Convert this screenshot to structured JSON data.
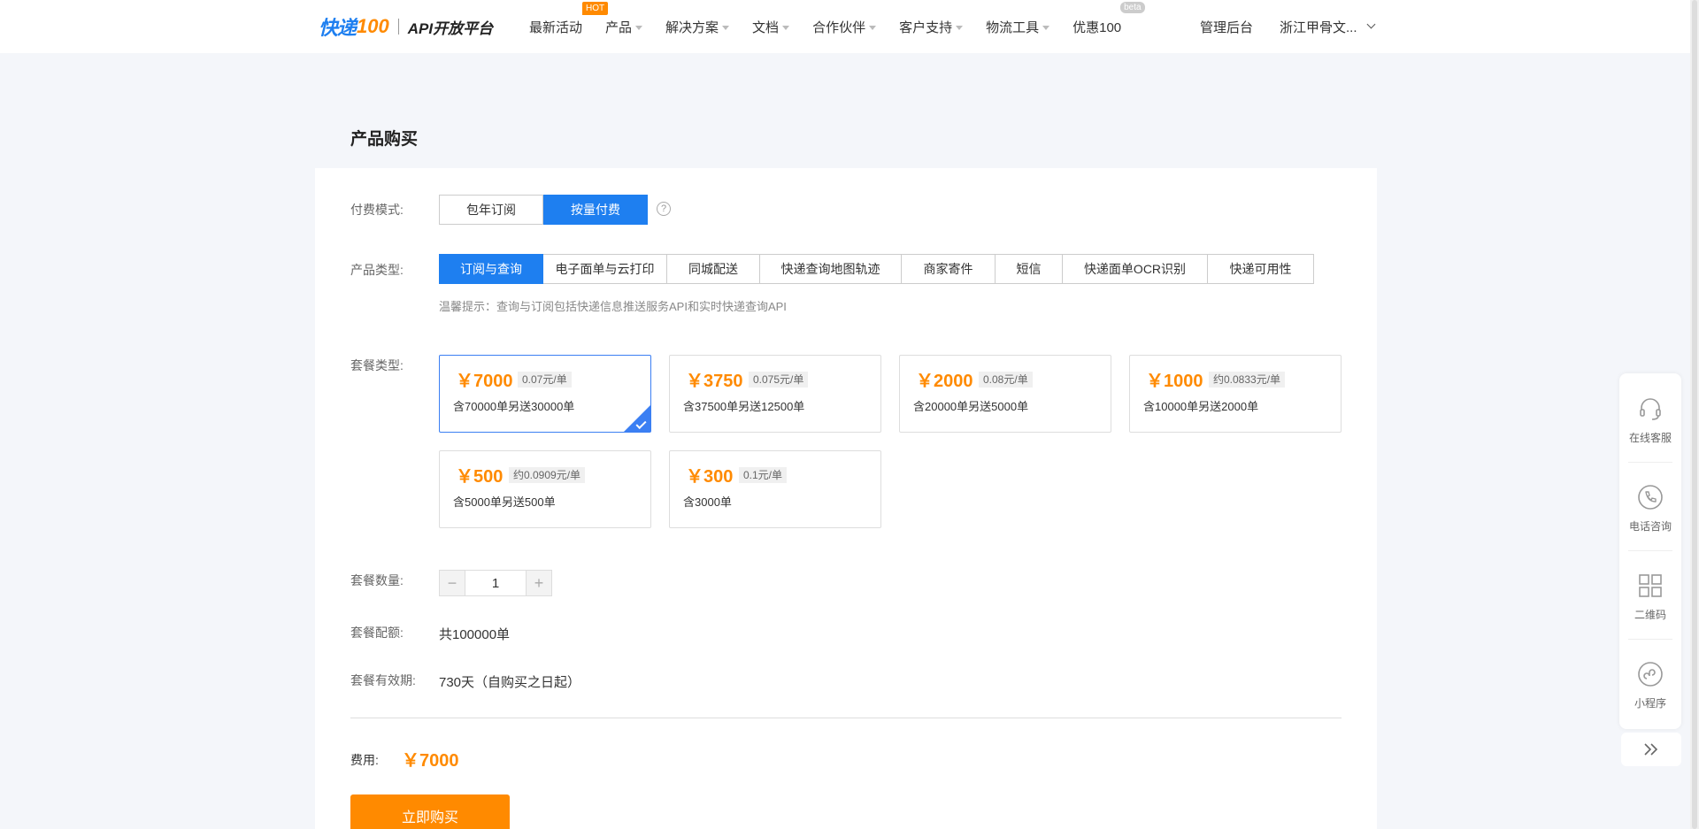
{
  "header": {
    "logo_kd": "快递",
    "logo_100": "100",
    "logo_api": "API开放平台",
    "nav": [
      {
        "label": "最新活动",
        "badge": "HOT",
        "caret": false
      },
      {
        "label": "产品",
        "caret": true
      },
      {
        "label": "解决方案",
        "caret": true
      },
      {
        "label": "文档",
        "caret": true
      },
      {
        "label": "合作伙伴",
        "caret": true
      },
      {
        "label": "客户支持",
        "caret": true
      },
      {
        "label": "物流工具",
        "caret": true
      },
      {
        "label": "优惠100",
        "badge": "beta",
        "caret": false
      }
    ],
    "admin": "管理后台",
    "user": "浙江甲骨文..."
  },
  "page_title": "产品购买",
  "form": {
    "pay_mode_label": "付费模式:",
    "pay_modes": [
      "包年订阅",
      "按量付费"
    ],
    "pay_mode_selected": "按量付费",
    "help_glyph": "?",
    "product_type_label": "产品类型:",
    "product_types": [
      "订阅与查询",
      "电子面单与云打印",
      "同城配送",
      "快递查询地图轨迹",
      "商家寄件",
      "短信",
      "快递面单OCR识别",
      "快递可用性"
    ],
    "product_type_selected": "订阅与查询",
    "tip": "温馨提示：查询与订阅包括快递信息推送服务API和实时快递查询API",
    "package_label": "套餐类型:",
    "packages": [
      {
        "price": "￥7000",
        "unit": "0.07元/单",
        "desc": "含70000单另送30000单",
        "selected": true
      },
      {
        "price": "￥3750",
        "unit": "0.075元/单",
        "desc": "含37500单另送12500单"
      },
      {
        "price": "￥2000",
        "unit": "0.08元/单",
        "desc": "含20000单另送5000单"
      },
      {
        "price": "￥1000",
        "unit": "约0.0833元/单",
        "desc": "含10000单另送2000单"
      },
      {
        "price": "￥500",
        "unit": "约0.0909元/单",
        "desc": "含5000单另送500单"
      },
      {
        "price": "￥300",
        "unit": "0.1元/单",
        "desc": "含3000单"
      }
    ],
    "quantity_label": "套餐数量:",
    "quantity": "1",
    "minus": "−",
    "plus": "+",
    "quota_label": "套餐配额:",
    "quota": "共100000单",
    "validity_label": "套餐有效期:",
    "validity": "730天（自购买之日起）",
    "fee_label": "费用:",
    "fee": "￥7000",
    "buy_label": "立即购买"
  },
  "sidebar": {
    "items": [
      {
        "label": "在线客服",
        "icon": "headset-icon"
      },
      {
        "label": "电话咨询",
        "icon": "phone-icon"
      },
      {
        "label": "二维码",
        "icon": "qrcode-icon"
      },
      {
        "label": "小程序",
        "icon": "mini-program-icon"
      }
    ],
    "toggle": "»"
  },
  "colors": {
    "primary": "#1e7ff0",
    "accent": "#ff8a00"
  }
}
